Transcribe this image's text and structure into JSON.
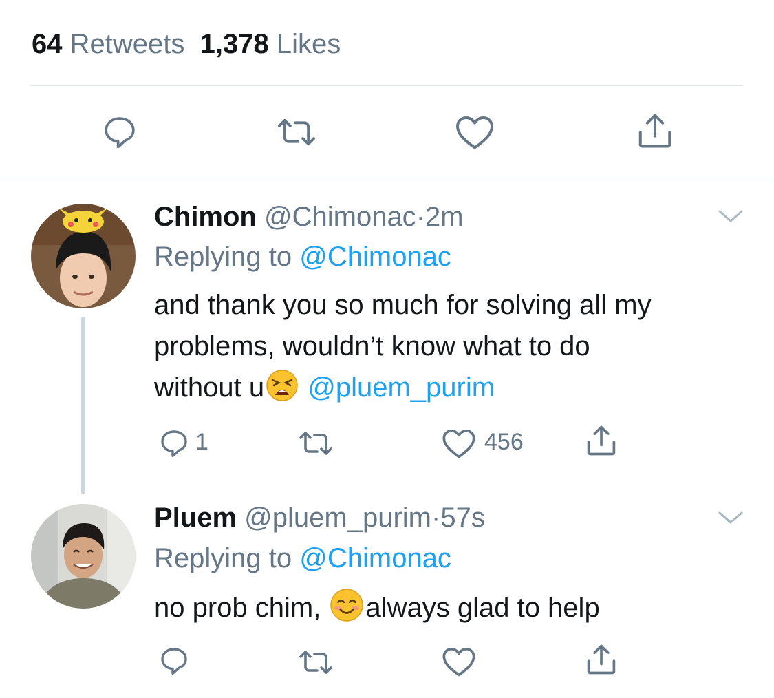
{
  "stats": {
    "retweets_count": "64",
    "retweets_label": "Retweets",
    "likes_count": "1,378",
    "likes_label": "Likes"
  },
  "main_actions": [
    "reply-icon",
    "retweet-icon",
    "like-icon",
    "share-icon"
  ],
  "tweets": [
    {
      "name": "Chimon",
      "handle": "@Chimonac",
      "dot": "·",
      "time": "2m",
      "replying_prefix": "Replying to",
      "replying_to": "@Chimonac",
      "text_line1": "and thank you so much for solving all my",
      "text_line2": "problems, wouldn’t know what to do",
      "text_line3_a": "without u",
      "emoji": "weary-face-emoji",
      "text_line3_mention": "@pluem_purim",
      "reply_count": "1",
      "like_count": "456"
    },
    {
      "name": "Pluem",
      "handle": "@pluem_purim",
      "dot": "·",
      "time": "57s",
      "replying_prefix": "Replying to",
      "replying_to": "@Chimonac",
      "text_a": "no prob chim,",
      "emoji": "smiling-face-emoji",
      "text_b": "always glad to help"
    }
  ],
  "colors": {
    "accent": "#1da1f2",
    "muted": "#657786",
    "text": "#14171a",
    "divider": "#e1e8ed"
  }
}
